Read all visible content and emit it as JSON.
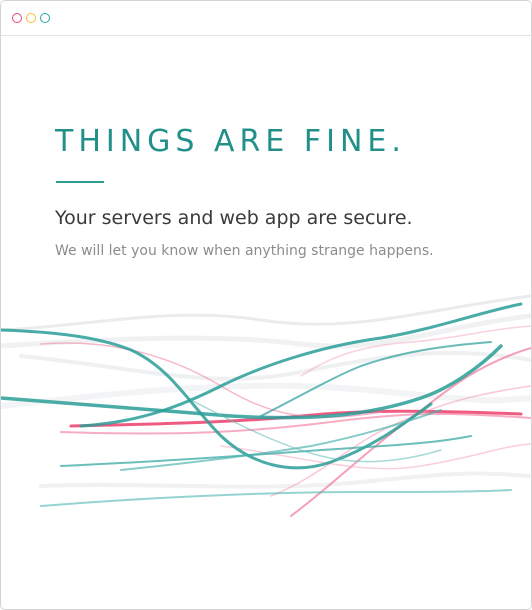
{
  "window": {
    "controls": [
      {
        "name": "close",
        "color": "#e8457a"
      },
      {
        "name": "minimize",
        "color": "#f1c02d"
      },
      {
        "name": "maximize",
        "color": "#2ba6a0"
      }
    ]
  },
  "status": {
    "headline": "THINGS ARE FINE.",
    "subtitle": "Your servers and web app are secure.",
    "note": "We will let you know when anything strange happens."
  },
  "theme": {
    "accent": "#219089",
    "traffic_teal": "#2a9e98",
    "traffic_pink": "#ec3f6c",
    "traffic_grey": "#dfe2e6"
  }
}
